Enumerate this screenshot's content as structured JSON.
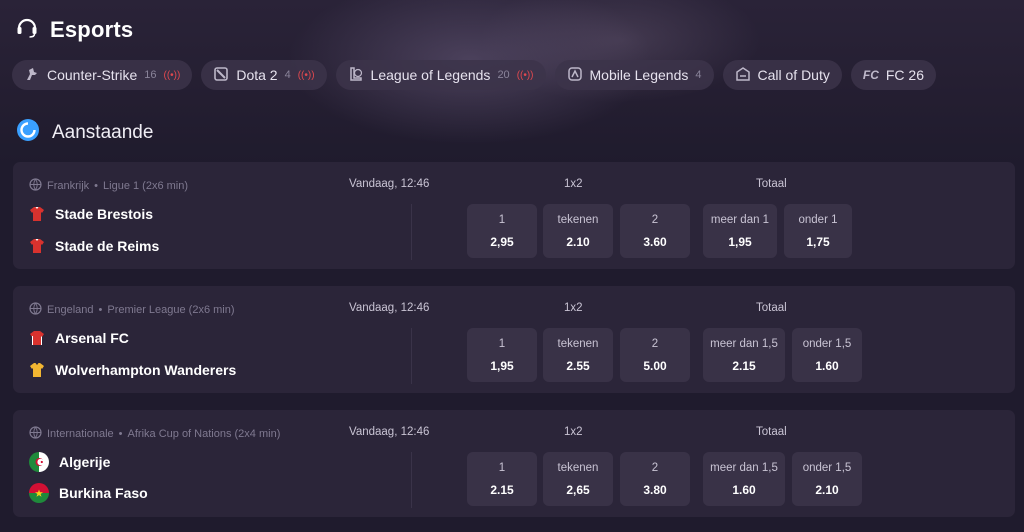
{
  "header": {
    "title": "Esports"
  },
  "tabs": [
    {
      "label": "Counter-Strike",
      "count": "16",
      "live": true,
      "icon": "counter-strike-icon"
    },
    {
      "label": "Dota 2",
      "count": "4",
      "live": true,
      "icon": "dota-icon"
    },
    {
      "label": "League of Legends",
      "count": "20",
      "live": true,
      "icon": "league-of-legends-icon"
    },
    {
      "label": "Mobile Legends",
      "count": "4",
      "live": false,
      "icon": "mobile-legends-icon"
    },
    {
      "label": "Call of Duty",
      "count": "",
      "live": false,
      "icon": "call-of-duty-icon"
    },
    {
      "label": "FC 26",
      "count": "",
      "live": false,
      "icon": "fc-icon"
    }
  ],
  "section": {
    "title": "Aanstaande"
  },
  "matches": [
    {
      "country": "Frankrijk",
      "league": "Ligue 1 (2x6 min)",
      "time": "Vandaag, 12:46",
      "team1": "Stade Brestois",
      "team2": "Stade de Reims",
      "group1x2": "1x2",
      "groupTotal": "Totaal",
      "odds": [
        {
          "label": "1",
          "value": "2,95"
        },
        {
          "label": "tekenen",
          "value": "2.10"
        },
        {
          "label": "2",
          "value": "3.60"
        },
        {
          "label": "meer dan 1",
          "value": "1,95"
        },
        {
          "label": "onder 1",
          "value": "1,75"
        }
      ]
    },
    {
      "country": "Engeland",
      "league": "Premier League (2x6 min)",
      "time": "Vandaag, 12:46",
      "team1": "Arsenal FC",
      "team2": "Wolverhampton Wanderers",
      "group1x2": "1x2",
      "groupTotal": "Totaal",
      "odds": [
        {
          "label": "1",
          "value": "1,95"
        },
        {
          "label": "tekenen",
          "value": "2.55"
        },
        {
          "label": "2",
          "value": "5.00"
        },
        {
          "label": "meer dan 1,5",
          "value": "2.15"
        },
        {
          "label": "onder 1,5",
          "value": "1.60"
        }
      ]
    },
    {
      "country": "Internationale",
      "league": "Afrika Cup of Nations (2x4 min)",
      "time": "Vandaag, 12:46",
      "team1": "Algerije",
      "team2": "Burkina Faso",
      "group1x2": "1x2",
      "groupTotal": "Totaal",
      "odds": [
        {
          "label": "1",
          "value": "2.15"
        },
        {
          "label": "tekenen",
          "value": "2,65"
        },
        {
          "label": "2",
          "value": "3.80"
        },
        {
          "label": "meer dan 1,5",
          "value": "1.60"
        },
        {
          "label": "onder 1,5",
          "value": "2.10"
        }
      ]
    }
  ],
  "colors": {
    "accent": "#3aa0ff",
    "live": "#e0484f",
    "card": "#2b2539",
    "oddBox": "#393247"
  }
}
